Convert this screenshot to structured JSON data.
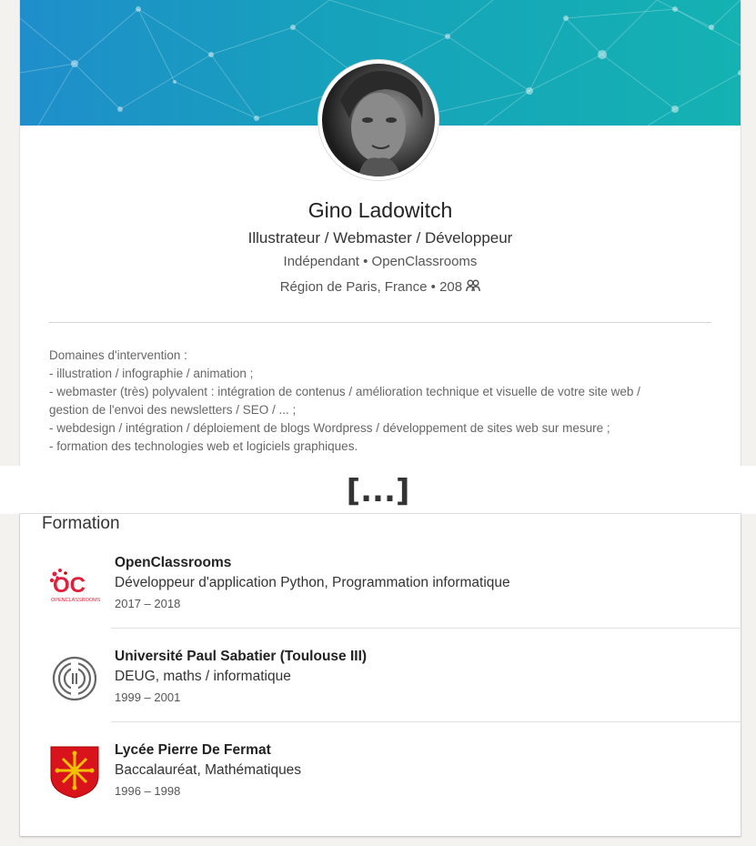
{
  "profile": {
    "name": "Gino Ladowitch",
    "headline": "Illustrateur / Webmaster / Développeur",
    "company_line": "Indépendant • OpenClassrooms",
    "location": "Région de Paris, France",
    "connections": "208",
    "connections_icon": "people-icon"
  },
  "about": {
    "lines": [
      "Domaines d'intervention :",
      "- illustration / infographie / animation ;",
      "- webmaster (très) polyvalent : intégration de contenus / amélioration technique et visuelle de votre site web /",
      "gestion de l'envoi des newsletters / SEO / ... ;",
      "- webdesign / intégration / déploiement de blogs Wordpress / développement de sites web sur mesure ;",
      "- formation des technologies web et logiciels graphiques."
    ]
  },
  "ellipsis": "[...]",
  "education": {
    "title": "Formation",
    "items": [
      {
        "school": "OpenClassrooms",
        "degree": "Développeur d'application Python, Programmation informatique",
        "dates": "2017 – 2018",
        "logo": "openclassrooms-logo",
        "logo_text": "OC",
        "logo_subtext": "OPENCLASSROOMS"
      },
      {
        "school": "Université Paul Sabatier (Toulouse III)",
        "degree": "DEUG, maths / informatique",
        "dates": "1999 – 2001",
        "logo": "paul-sabatier-logo"
      },
      {
        "school": "Lycée Pierre De Fermat",
        "degree": "Baccalauréat, Mathématiques",
        "dates": "1996 – 1998",
        "logo": "occitan-cross-shield-logo"
      }
    ]
  },
  "colors": {
    "banner_start": "#1f8ecb",
    "banner_end": "#14b2b2",
    "oc_red": "#e0203a",
    "shield_red": "#d8131c",
    "shield_gold": "#f2c200"
  }
}
